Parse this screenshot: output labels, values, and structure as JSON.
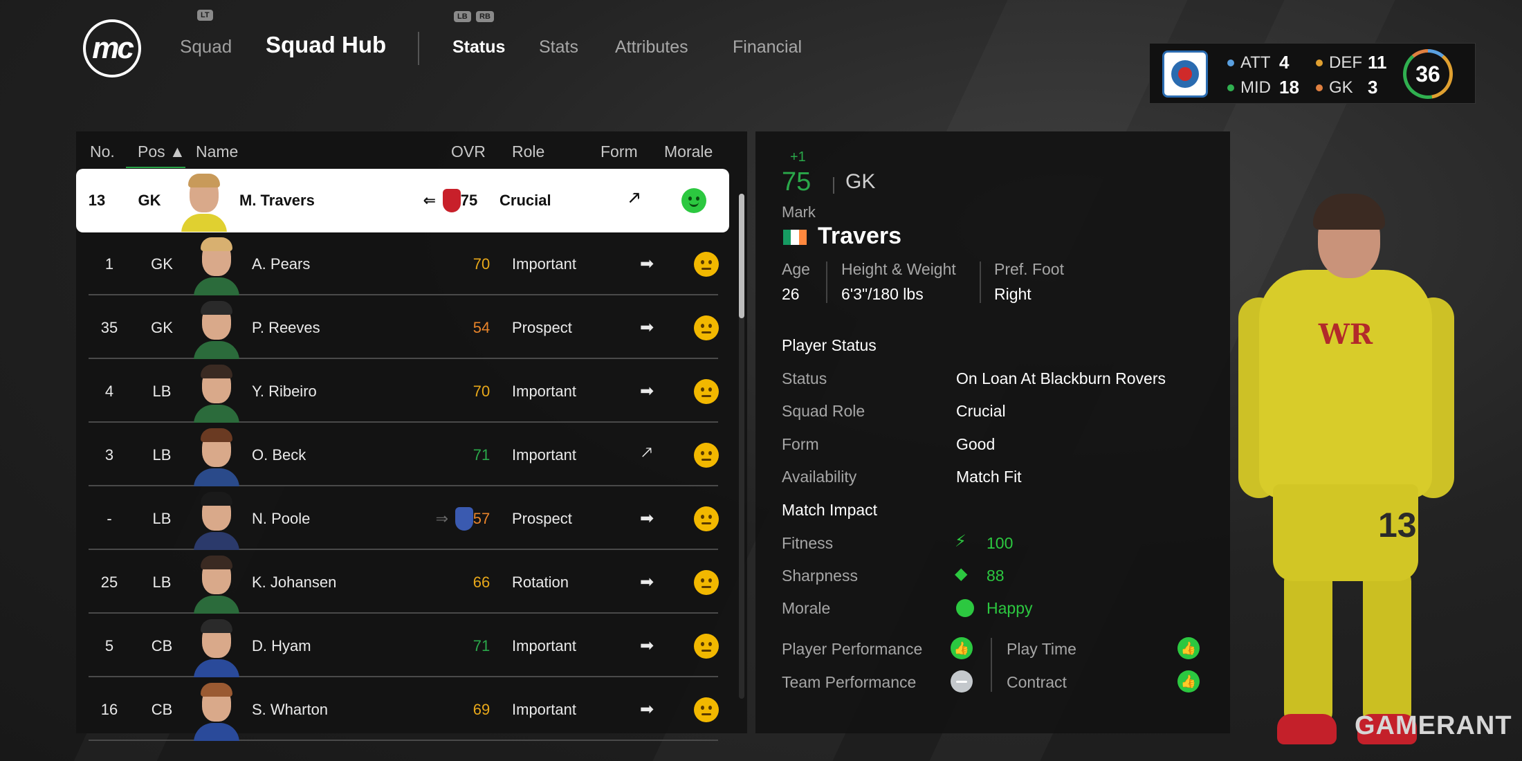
{
  "header": {
    "logo_text": "mc",
    "hint_lt": "LT",
    "hint_lb": "LB",
    "hint_rb": "RB",
    "squad_link": "Squad",
    "hub_title": "Squad Hub",
    "tabs": [
      {
        "label": "Status",
        "active": true
      },
      {
        "label": "Stats",
        "active": false
      },
      {
        "label": "Attributes",
        "active": false
      },
      {
        "label": "Financial",
        "active": false
      }
    ]
  },
  "summary": {
    "att_label": "ATT",
    "att": "4",
    "def_label": "DEF",
    "def": "11",
    "mid_label": "MID",
    "mid": "18",
    "gk_label": "GK",
    "gk": "3",
    "total": "36",
    "colors": {
      "att": "#5aa0e0",
      "def": "#e0a030",
      "mid": "#30b050",
      "gk": "#e08040"
    }
  },
  "table": {
    "headers": {
      "no": "No.",
      "pos": "Pos ▲",
      "name": "Name",
      "ovr": "OVR",
      "role": "Role",
      "form": "Form",
      "morale": "Morale"
    },
    "rows": [
      {
        "no": "13",
        "pos": "GK",
        "name": "M. Travers",
        "ovr": "75",
        "ovr_color": "#111111",
        "role": "Crucial",
        "form": "🡕",
        "morale": "happy",
        "loan": "⇐",
        "badge": "#c8202a",
        "selected": true
      },
      {
        "no": "1",
        "pos": "GK",
        "name": "A. Pears",
        "ovr": "70",
        "ovr_color": "#e8a81a",
        "role": "Important",
        "form": "➡",
        "morale": "neutral"
      },
      {
        "no": "35",
        "pos": "GK",
        "name": "P. Reeves",
        "ovr": "54",
        "ovr_color": "#e8842a",
        "role": "Prospect",
        "form": "➡",
        "morale": "neutral"
      },
      {
        "no": "4",
        "pos": "LB",
        "name": "Y. Ribeiro",
        "ovr": "70",
        "ovr_color": "#e8a81a",
        "role": "Important",
        "form": "➡",
        "morale": "neutral"
      },
      {
        "no": "3",
        "pos": "LB",
        "name": "O. Beck",
        "ovr": "71",
        "ovr_color": "#2aa84a",
        "role": "Important",
        "form": "🡕",
        "morale": "neutral"
      },
      {
        "no": "-",
        "pos": "LB",
        "name": "N. Poole",
        "ovr": "57",
        "ovr_color": "#e8842a",
        "role": "Prospect",
        "form": "➡",
        "morale": "neutral",
        "loan": "⇒",
        "badge": "#3a5ab0"
      },
      {
        "no": "25",
        "pos": "LB",
        "name": "K. Johansen",
        "ovr": "66",
        "ovr_color": "#e8a81a",
        "role": "Rotation",
        "form": "➡",
        "morale": "neutral"
      },
      {
        "no": "5",
        "pos": "CB",
        "name": "D. Hyam",
        "ovr": "71",
        "ovr_color": "#2aa84a",
        "role": "Important",
        "form": "➡",
        "morale": "neutral"
      },
      {
        "no": "16",
        "pos": "CB",
        "name": "S. Wharton",
        "ovr": "69",
        "ovr_color": "#e8a81a",
        "role": "Important",
        "form": "➡",
        "morale": "neutral"
      }
    ]
  },
  "detail": {
    "ovr_change": "+1",
    "ovr": "75",
    "position": "GK",
    "first_name": "Mark",
    "last_name": "Travers",
    "flag_colors": [
      "#169b62",
      "#ffffff",
      "#ff883e"
    ],
    "age_label": "Age",
    "age": "26",
    "hw_label": "Height & Weight",
    "hw": "6'3\"/180 lbs",
    "foot_label": "Pref. Foot",
    "foot": "Right",
    "player_status_head": "Player Status",
    "status_label": "Status",
    "status": "On Loan At Blackburn Rovers",
    "role_label": "Squad Role",
    "role": "Crucial",
    "form_label": "Form",
    "form": "Good",
    "avail_label": "Availability",
    "avail": "Match Fit",
    "impact_head": "Match Impact",
    "fitness_label": "Fitness",
    "fitness": "100",
    "sharp_label": "Sharpness",
    "sharp": "88",
    "morale_label": "Morale",
    "morale": "Happy",
    "pp_label": "Player Performance",
    "tp_label": "Team Performance",
    "pt_label": "Play Time",
    "ct_label": "Contract"
  },
  "figure": {
    "sponsor": "WR",
    "shirt_number": "13"
  },
  "watermark": "GAMERANT"
}
